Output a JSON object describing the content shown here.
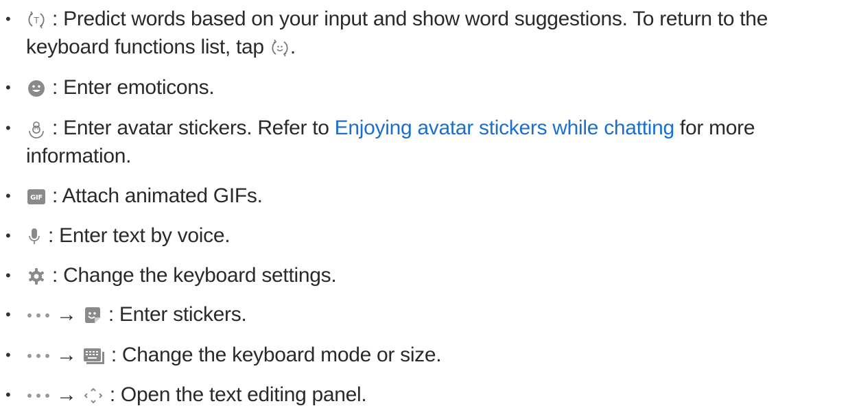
{
  "items": [
    {
      "icon": "predict-text-icon",
      "text1": ": Predict words based on your input and show word suggestions. To return to the",
      "text2a": "keyboard functions list, tap ",
      "text2_icon": "keyboard-functions-icon",
      "text2b": "."
    },
    {
      "icon": "emoji-icon",
      "text": ": Enter emoticons."
    },
    {
      "icon": "avatar-sticker-icon",
      "text_pre": ": Enter avatar stickers. Refer to ",
      "link": "Enjoying avatar stickers while chatting",
      "text_post": " for more",
      "text2": "information."
    },
    {
      "icon": "gif-icon",
      "text": ": Attach animated GIFs."
    },
    {
      "icon": "microphone-icon",
      "text": ": Enter text by voice."
    },
    {
      "icon": "gear-icon",
      "text": ": Change the keyboard settings."
    },
    {
      "prefix_icon": "more-dots-icon",
      "arrow": "→",
      "icon": "sticker-icon",
      "text": ": Enter stickers."
    },
    {
      "prefix_icon": "more-dots-icon",
      "arrow": "→",
      "icon": "keyboard-mode-icon",
      "text": ": Change the keyboard mode or size."
    },
    {
      "prefix_icon": "more-dots-icon",
      "arrow": "→",
      "icon": "text-editing-icon",
      "text": ": Open the text editing panel."
    }
  ],
  "colors": {
    "text": "#2a2a2a",
    "link": "#1a6fd1",
    "icon": "#8a8a8a"
  }
}
